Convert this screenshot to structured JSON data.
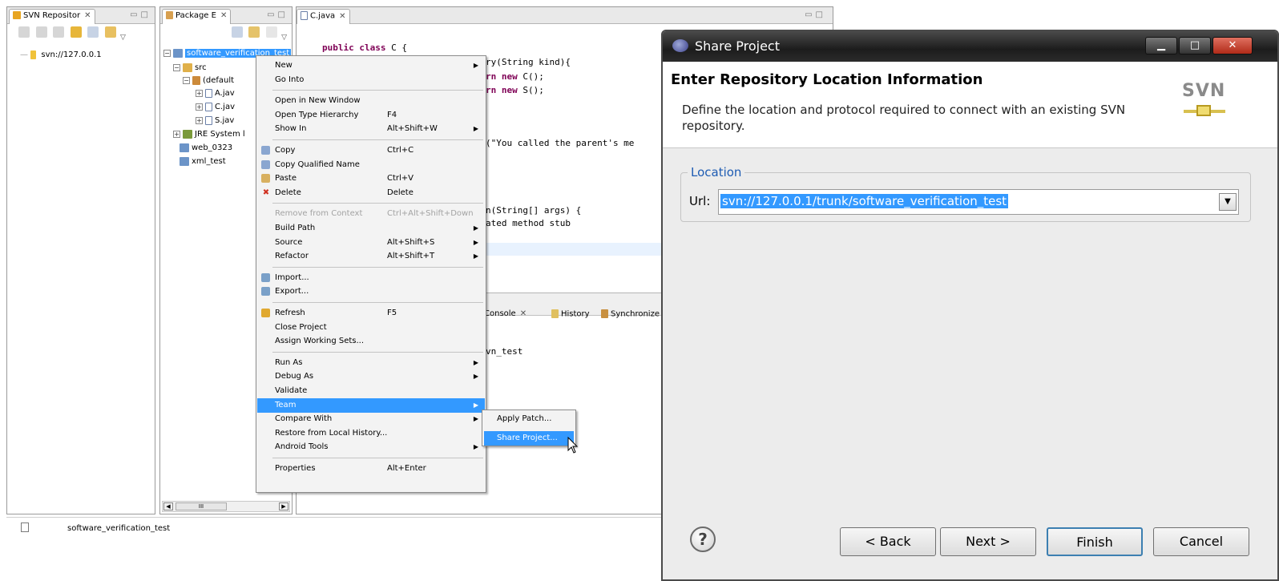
{
  "svn_view": {
    "tab_label": "SVN Repositor",
    "repo_item": "svn://127.0.0.1"
  },
  "package_explorer": {
    "tab_label": "Package E",
    "tree": {
      "project": "software_verification_test",
      "src": "src",
      "default_pkg": "(default",
      "files": [
        "A.jav",
        "C.jav",
        "S.jav"
      ],
      "jre": "JRE System l",
      "web": "web_0323",
      "xml": "xml_test"
    },
    "scroll_mark": "III"
  },
  "editor": {
    "tab_label": "C.java",
    "code_lines": [
      {
        "kw": "public class",
        "rest": " C {"
      },
      {
        "kw": "",
        "rest": "ry(String kind){"
      },
      {
        "kw": "rn new",
        "rest": " C();"
      },
      {
        "kw": "rn new",
        "rest": " S();"
      },
      {
        "kw": "",
        "rest": "(\"You called the parent's me"
      },
      {
        "kw": "",
        "rest": "n(String[] args) {"
      },
      {
        "kw": "",
        "rest": "ated method stub"
      }
    ]
  },
  "console": {
    "tabs": [
      "Console",
      "History",
      "Synchronize"
    ],
    "text": "vn_test"
  },
  "status_bar": {
    "text": "software_verification_test"
  },
  "context_menu": {
    "items": [
      {
        "label": "New",
        "accel": "",
        "submenu": true,
        "icon": "",
        "state": "normal"
      },
      {
        "label": "Go Into",
        "accel": "",
        "submenu": false,
        "icon": "",
        "state": "normal"
      },
      {
        "sep": true
      },
      {
        "label": "Open in New Window",
        "accel": "",
        "submenu": false,
        "icon": "",
        "state": "normal"
      },
      {
        "label": "Open Type Hierarchy",
        "accel": "F4",
        "submenu": false,
        "icon": "",
        "state": "normal"
      },
      {
        "label": "Show In",
        "accel": "Alt+Shift+W",
        "submenu": true,
        "icon": "",
        "state": "normal"
      },
      {
        "sep": true
      },
      {
        "label": "Copy",
        "accel": "Ctrl+C",
        "submenu": false,
        "icon": "copy-icon",
        "state": "normal"
      },
      {
        "label": "Copy Qualified Name",
        "accel": "",
        "submenu": false,
        "icon": "copy-icon",
        "state": "normal"
      },
      {
        "label": "Paste",
        "accel": "Ctrl+V",
        "submenu": false,
        "icon": "paste-icon",
        "state": "normal"
      },
      {
        "label": "Delete",
        "accel": "Delete",
        "submenu": false,
        "icon": "delete-icon",
        "state": "normal"
      },
      {
        "sep": true
      },
      {
        "label": "Remove from Context",
        "accel": "Ctrl+Alt+Shift+Down",
        "submenu": false,
        "icon": "",
        "state": "disabled"
      },
      {
        "label": "Build Path",
        "accel": "",
        "submenu": true,
        "icon": "",
        "state": "normal"
      },
      {
        "label": "Source",
        "accel": "Alt+Shift+S",
        "submenu": true,
        "icon": "",
        "state": "normal"
      },
      {
        "label": "Refactor",
        "accel": "Alt+Shift+T",
        "submenu": true,
        "icon": "",
        "state": "normal"
      },
      {
        "sep": true
      },
      {
        "label": "Import...",
        "accel": "",
        "submenu": false,
        "icon": "import-icon",
        "state": "normal"
      },
      {
        "label": "Export...",
        "accel": "",
        "submenu": false,
        "icon": "export-icon",
        "state": "normal"
      },
      {
        "sep": true
      },
      {
        "label": "Refresh",
        "accel": "F5",
        "submenu": false,
        "icon": "refresh-icon",
        "state": "normal"
      },
      {
        "label": "Close Project",
        "accel": "",
        "submenu": false,
        "icon": "",
        "state": "normal"
      },
      {
        "label": "Assign Working Sets...",
        "accel": "",
        "submenu": false,
        "icon": "",
        "state": "normal"
      },
      {
        "sep": true
      },
      {
        "label": "Run As",
        "accel": "",
        "submenu": true,
        "icon": "",
        "state": "normal"
      },
      {
        "label": "Debug As",
        "accel": "",
        "submenu": true,
        "icon": "",
        "state": "normal"
      },
      {
        "label": "Validate",
        "accel": "",
        "submenu": false,
        "icon": "",
        "state": "normal"
      },
      {
        "label": "Team",
        "accel": "",
        "submenu": true,
        "icon": "",
        "state": "highlighted"
      },
      {
        "label": "Compare With",
        "accel": "",
        "submenu": true,
        "icon": "",
        "state": "normal"
      },
      {
        "label": "Restore from Local History...",
        "accel": "",
        "submenu": false,
        "icon": "",
        "state": "normal"
      },
      {
        "label": "Android Tools",
        "accel": "",
        "submenu": true,
        "icon": "",
        "state": "normal"
      },
      {
        "sep": true
      },
      {
        "label": "Properties",
        "accel": "Alt+Enter",
        "submenu": false,
        "icon": "",
        "state": "normal"
      }
    ]
  },
  "team_submenu": {
    "items": [
      {
        "label": "Apply Patch...",
        "state": "normal"
      },
      {
        "label": "Share Project...",
        "state": "highlighted"
      }
    ]
  },
  "dialog": {
    "title": "Share Project",
    "heading": "Enter Repository Location Information",
    "description": "Define the location and protocol required to connect with an existing SVN repository.",
    "logo": "SVN",
    "group_label": "Location",
    "url_label": "Url:",
    "url_value": "svn://127.0.0.1/trunk/software_verification_test",
    "buttons": {
      "back": "< Back",
      "next": "Next >",
      "finish": "Finish",
      "cancel": "Cancel"
    },
    "help": "?"
  },
  "colors": {
    "selection": "#3399ff",
    "keyword": "#7f0055",
    "title_bar": "#1c1c1c"
  }
}
